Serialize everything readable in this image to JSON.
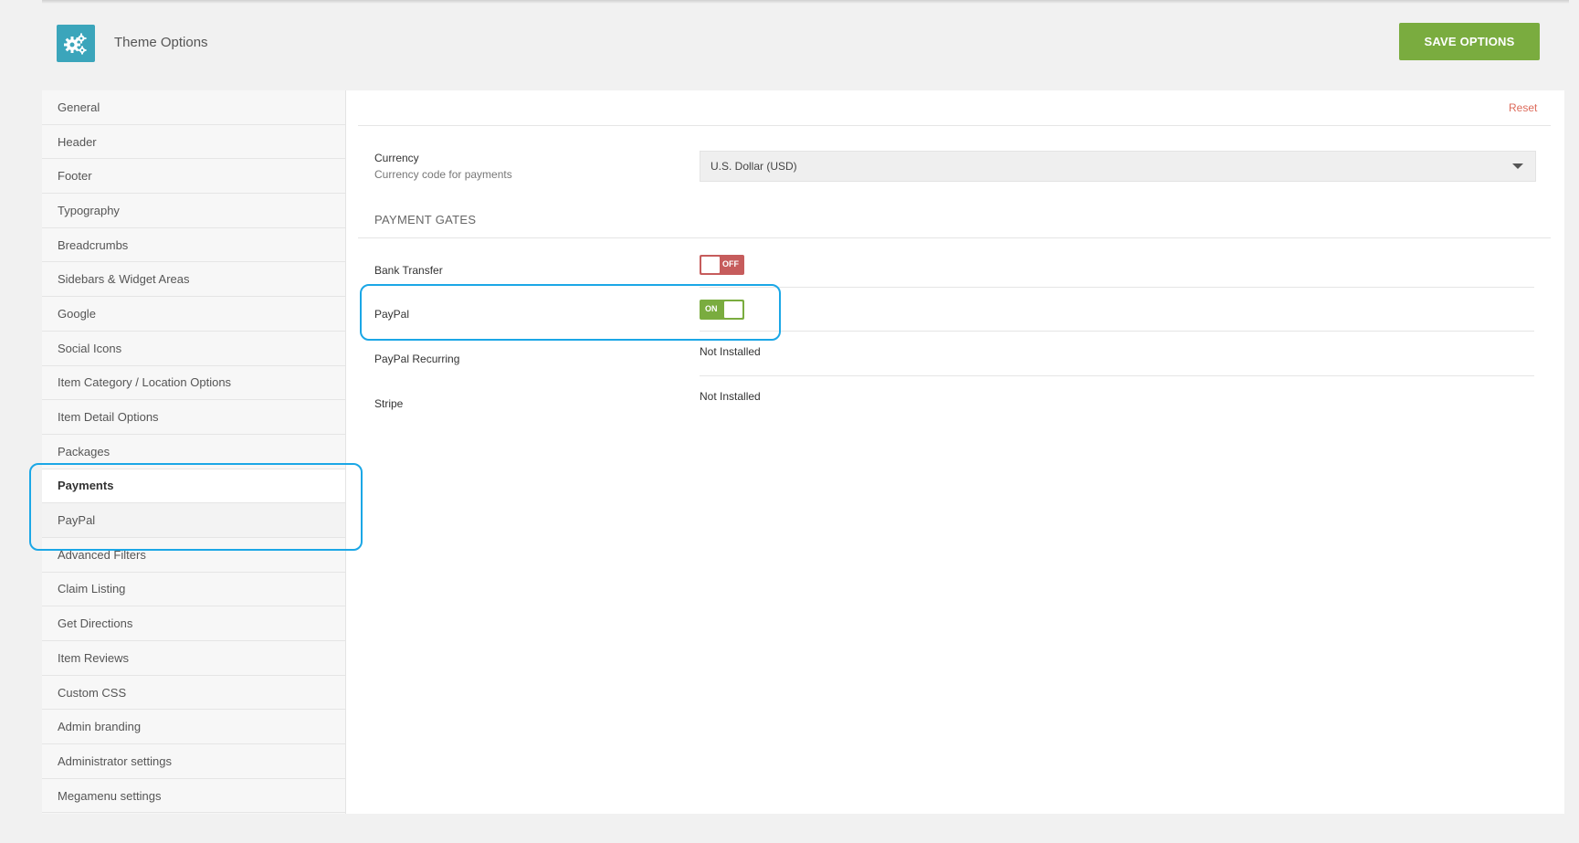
{
  "header": {
    "title": "Theme Options",
    "save_label": "SAVE OPTIONS",
    "logo_icon": "gears-icon",
    "logo_color": "#3ba5bb",
    "save_color": "#7aac3f"
  },
  "sidebar": {
    "items": [
      {
        "label": "General"
      },
      {
        "label": "Header"
      },
      {
        "label": "Footer"
      },
      {
        "label": "Typography"
      },
      {
        "label": "Breadcrumbs"
      },
      {
        "label": "Sidebars & Widget Areas"
      },
      {
        "label": "Google"
      },
      {
        "label": "Social Icons"
      },
      {
        "label": "Item Category / Location Options"
      },
      {
        "label": "Item Detail Options"
      },
      {
        "label": "Packages"
      },
      {
        "label": "Payments"
      },
      {
        "label": "PayPal"
      },
      {
        "label": "Advanced Filters"
      },
      {
        "label": "Claim Listing"
      },
      {
        "label": "Get Directions"
      },
      {
        "label": "Item Reviews"
      },
      {
        "label": "Custom CSS"
      },
      {
        "label": "Admin branding"
      },
      {
        "label": "Administrator settings"
      },
      {
        "label": "Megamenu settings"
      }
    ],
    "active": "Payments"
  },
  "main": {
    "reset_label": "Reset",
    "currency": {
      "label": "Currency",
      "description": "Currency code for payments",
      "value": "U.S. Dollar (USD)"
    },
    "section_title": "PAYMENT GATES",
    "gates": [
      {
        "label": "Bank Transfer",
        "state": "OFF"
      },
      {
        "label": "PayPal",
        "state": "ON"
      },
      {
        "label": "PayPal Recurring",
        "status": "Not Installed"
      },
      {
        "label": "Stripe",
        "status": "Not Installed"
      }
    ]
  },
  "colors": {
    "toggle_on": "#7aac3f",
    "toggle_off": "#c65c5c",
    "reset": "#dd6b5b",
    "highlight": "#1ba7e6"
  }
}
